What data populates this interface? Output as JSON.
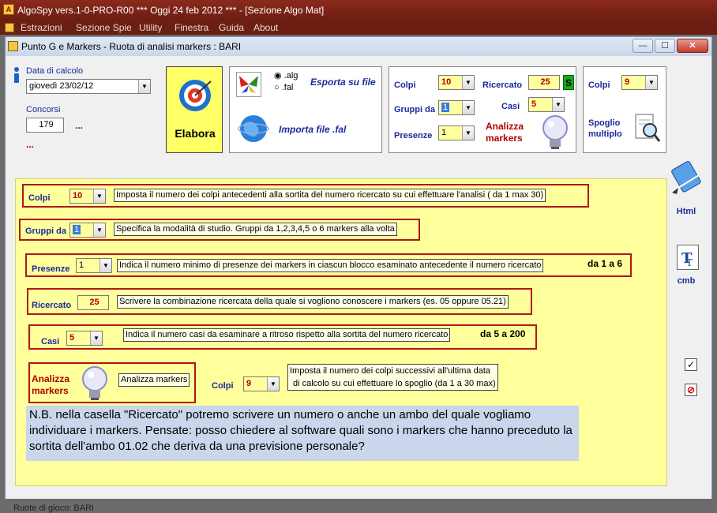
{
  "outer_window": {
    "title": "AlgoSpy vers.1-0-PRO-R00  ***  Oggi 24 feb 2012  ***  - [Sezione Algo Mat]",
    "menu": [
      "Estrazioni",
      "Sezione Spie",
      "Utility",
      "Finestra",
      "Guida",
      "About"
    ]
  },
  "inner_window": {
    "title": "Punto G e Markers - Ruota di analisi markers : BARI",
    "controls": {
      "minimize": "—",
      "maximize": "☐",
      "close": "✕"
    }
  },
  "data_calcolo": {
    "label": "Data di calcolo",
    "value": "giovedì 23/02/12"
  },
  "concorsi": {
    "label": "Concorsi",
    "value": "179",
    "more": "...",
    "more2": "..."
  },
  "elabora": {
    "label": "Elabora"
  },
  "export_panel": {
    "radio_alg": ".alg",
    "radio_fal": ".fal",
    "export_label": "Esporta su file",
    "import_label": "Importa file .fal"
  },
  "params_panel": {
    "colpi_label": "Colpi",
    "colpi_value": "10",
    "gruppi_label": "Gruppi da",
    "gruppi_value": "1",
    "presenze_label": "Presenze",
    "presenze_value": "1",
    "ricercato_label": "Ricercato",
    "ricercato_value": "25",
    "s_badge": "S",
    "casi_label": "Casi",
    "casi_value": "5",
    "analizza_label": "Analizza markers"
  },
  "spoglio_panel": {
    "colpi_label": "Colpi",
    "colpi_value": "9",
    "spoglio_label": "Spoglio multiplo"
  },
  "help_rows": {
    "colpi": {
      "label": "Colpi",
      "value": "10",
      "tip": "Imposta il numero dei colpi antecedenti alla sortita del numero ricercato su cui effettuare l'analisi ( da 1 max 30)"
    },
    "gruppi": {
      "label": "Gruppi da",
      "value": "1",
      "tip": "Specifica la modalità di studio. Gruppi da 1,2,3,4,5 o 6 markers alla volta"
    },
    "presenze": {
      "label": "Presenze",
      "value": "1",
      "tip": "Indica il numero minimo di presenze dei markers in ciascun blocco esaminato antecedente il numero ricercato",
      "range": "da 1 a 6"
    },
    "ricercato": {
      "label": "Ricercato",
      "value": "25",
      "tip": "Scrivere la combinazione ricercata della quale si vogliono conoscere i markers  (es. 05 oppure 05.21)"
    },
    "casi": {
      "label": "Casi",
      "value": "5",
      "tip": "Indica il numero casi da esaminare a ritroso rispetto alla sortita del numero ricercato",
      "range": "da 5 a 200"
    },
    "analizza": {
      "label": "Analizza markers",
      "tip": "Analizza markers"
    },
    "spoglio": {
      "label": "Colpi",
      "value": "9",
      "tip_line1": "Imposta il numero dei colpi successivi all'ultima data",
      "tip_line2": "di calcolo su cui effettuare lo spoglio (da 1 a 30 max)"
    }
  },
  "note": "N.B. nella casella \"Ricercato\" potremo scrivere un numero o anche un ambo del quale vogliamo individuare i markers. Pensate: posso chiedere al software quali sono i markers che hanno preceduto la sortita dell'ambo 01.02 che deriva da una previsione personale?",
  "side": {
    "html_label": "Html",
    "cmb_label": "cmb"
  },
  "status": "Ruote di gioco: BARI"
}
